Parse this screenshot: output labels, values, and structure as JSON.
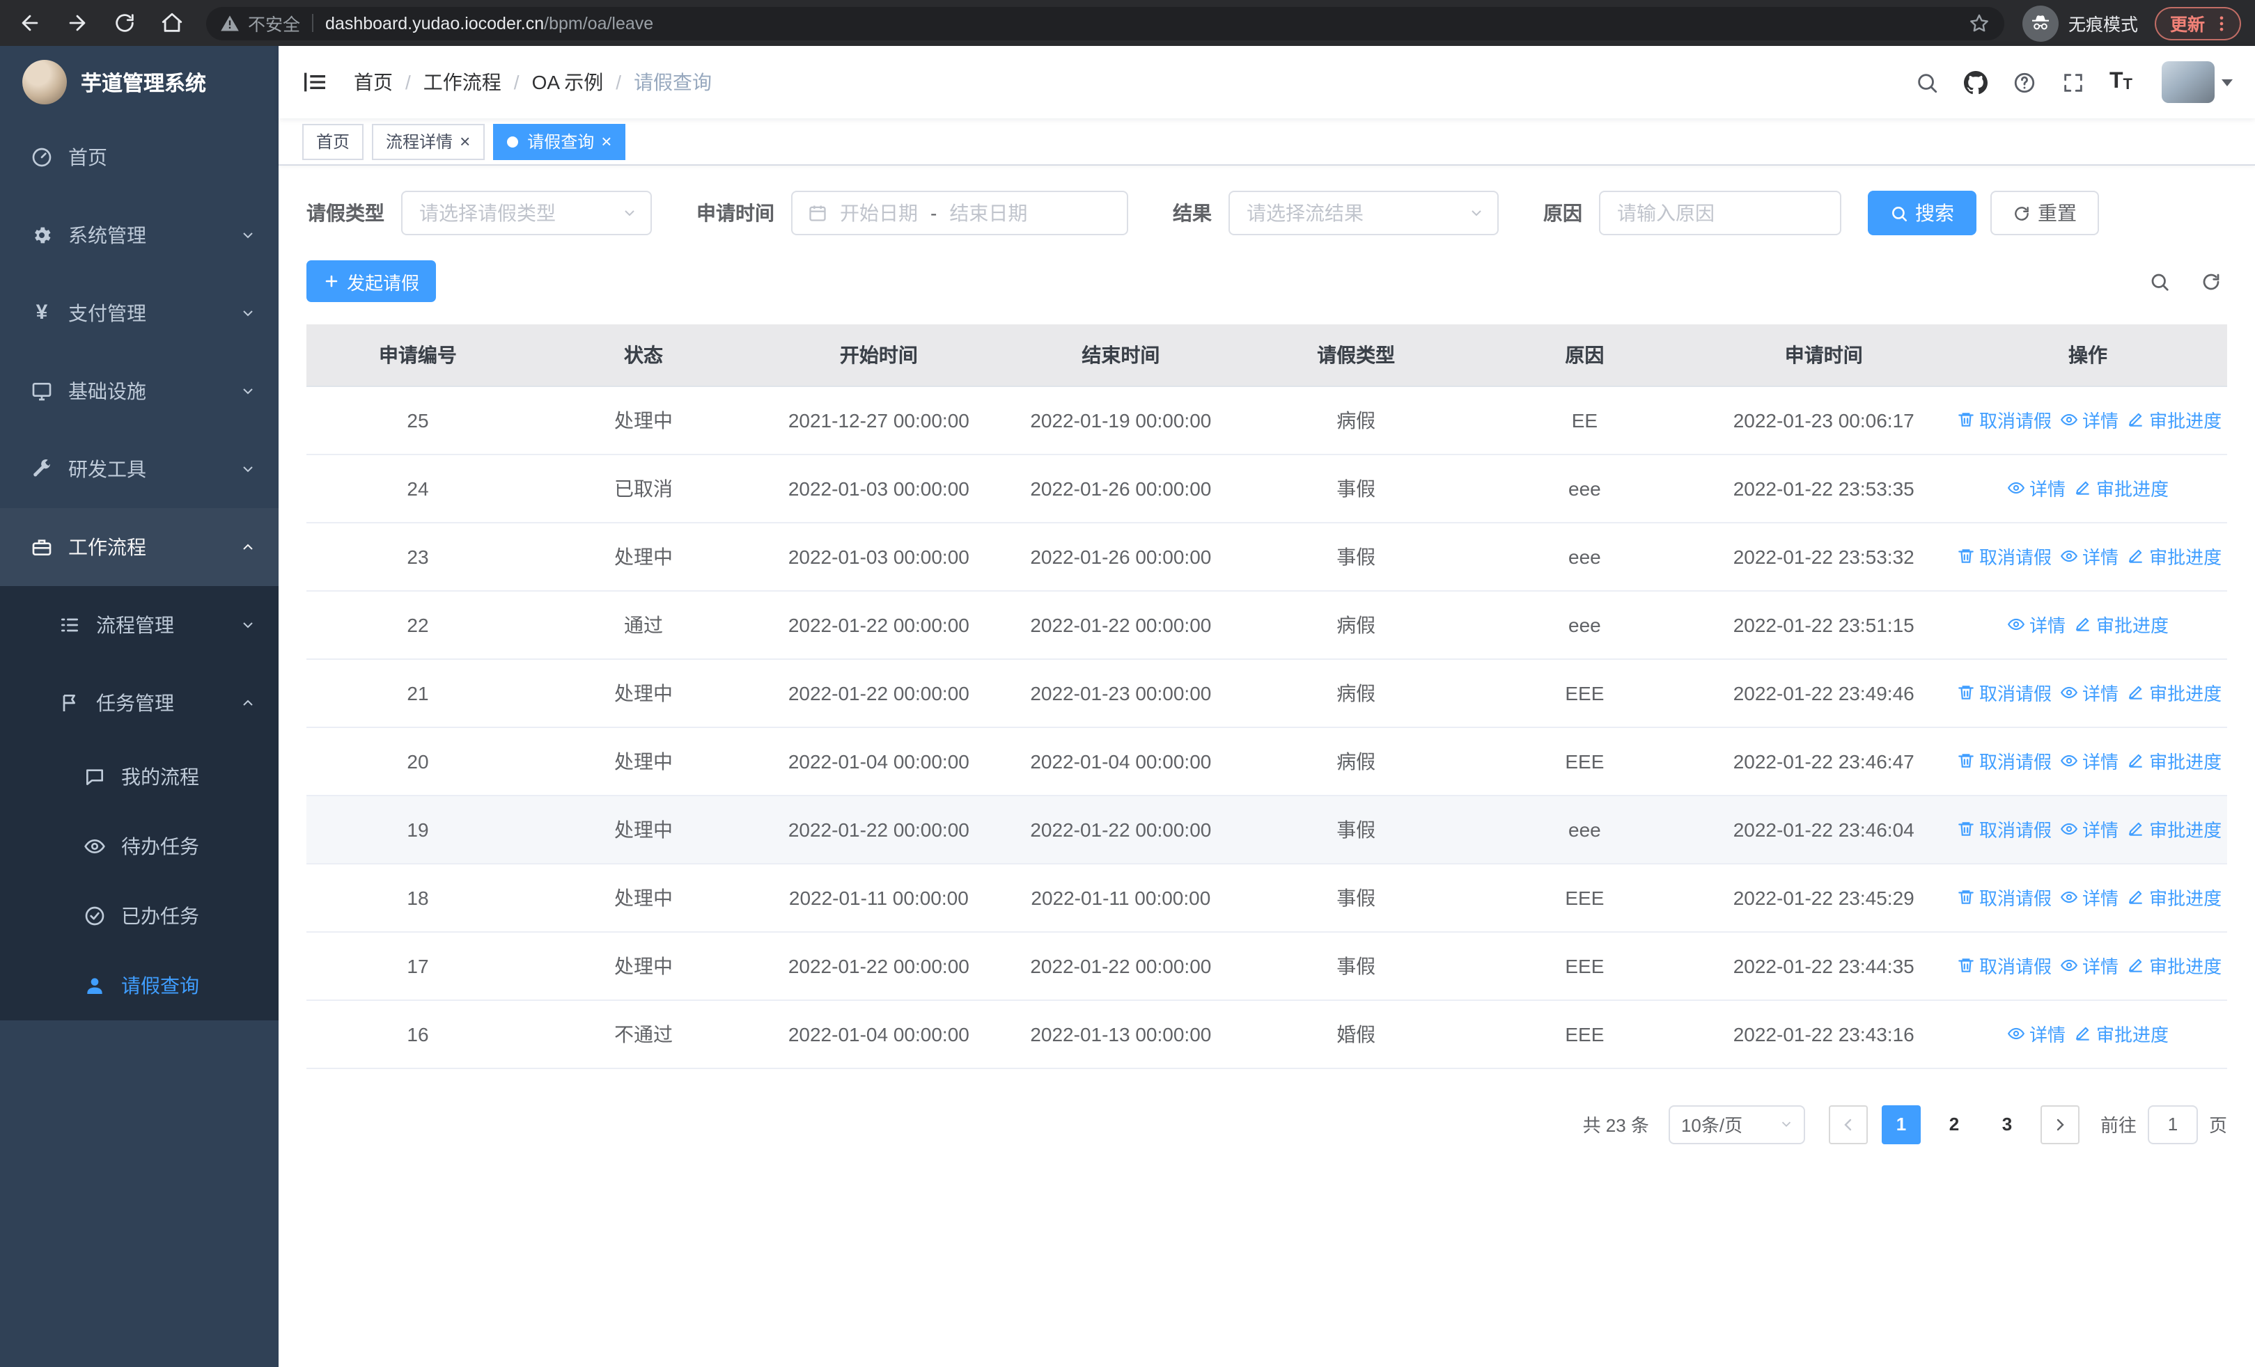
{
  "colors": {
    "accent": "#409eff",
    "sidebar_bg": "#304156",
    "submenu_bg": "#212d3d",
    "table_header_bg": "#e9e9eb"
  },
  "browser": {
    "security_label": "不安全",
    "url_host": "dashboard.yudao.iocoder.cn",
    "url_path": "/bpm/oa/leave",
    "incognito_label": "无痕模式",
    "update_label": "更新"
  },
  "sidebar": {
    "title": "芋道管理系统",
    "items": [
      {
        "label": "首页",
        "icon": "dashboard-icon"
      },
      {
        "label": "系统管理",
        "icon": "gear-icon"
      },
      {
        "label": "支付管理",
        "icon": "yen-icon"
      },
      {
        "label": "基础设施",
        "icon": "monitor-icon"
      },
      {
        "label": "研发工具",
        "icon": "wrench-icon"
      },
      {
        "label": "工作流程",
        "icon": "briefcase-icon"
      },
      {
        "label": "流程管理",
        "icon": "list-tree-icon"
      },
      {
        "label": "任务管理",
        "icon": "flag-icon"
      },
      {
        "label": "我的流程",
        "icon": "chat-icon"
      },
      {
        "label": "待办任务",
        "icon": "eye-icon"
      },
      {
        "label": "已办任务",
        "icon": "check-circle-icon"
      },
      {
        "label": "请假查询",
        "icon": "user-icon"
      }
    ]
  },
  "header": {
    "breadcrumb": [
      "首页",
      "工作流程",
      "OA 示例",
      "请假查询"
    ]
  },
  "tabs": [
    {
      "label": "首页"
    },
    {
      "label": "流程详情"
    },
    {
      "label": "请假查询"
    }
  ],
  "filters": {
    "leave_type_label": "请假类型",
    "leave_type_placeholder": "请选择请假类型",
    "apply_time_label": "申请时间",
    "start_date_placeholder": "开始日期",
    "range_separator": "-",
    "end_date_placeholder": "结束日期",
    "result_label": "结果",
    "result_placeholder": "请选择流结果",
    "reason_label": "原因",
    "reason_placeholder": "请输入原因",
    "search_label": "搜索",
    "reset_label": "重置"
  },
  "toolbar": {
    "create_label": "发起请假"
  },
  "table": {
    "columns": [
      "申请编号",
      "状态",
      "开始时间",
      "结束时间",
      "请假类型",
      "原因",
      "申请时间",
      "操作"
    ],
    "action_labels": {
      "cancel": "取消请假",
      "detail": "详情",
      "progress": "审批进度"
    },
    "action_icons": {
      "cancel": "delete-icon",
      "detail": "eye-icon",
      "progress": "edit-icon"
    },
    "rows": [
      {
        "id": "25",
        "status": "处理中",
        "start": "2021-12-27 00:00:00",
        "end": "2022-01-19 00:00:00",
        "type": "病假",
        "reason": "EE",
        "apply_time": "2022-01-23 00:06:17",
        "actions": [
          "cancel",
          "detail",
          "progress"
        ]
      },
      {
        "id": "24",
        "status": "已取消",
        "start": "2022-01-03 00:00:00",
        "end": "2022-01-26 00:00:00",
        "type": "事假",
        "reason": "eee",
        "apply_time": "2022-01-22 23:53:35",
        "actions": [
          "detail",
          "progress"
        ]
      },
      {
        "id": "23",
        "status": "处理中",
        "start": "2022-01-03 00:00:00",
        "end": "2022-01-26 00:00:00",
        "type": "事假",
        "reason": "eee",
        "apply_time": "2022-01-22 23:53:32",
        "actions": [
          "cancel",
          "detail",
          "progress"
        ]
      },
      {
        "id": "22",
        "status": "通过",
        "start": "2022-01-22 00:00:00",
        "end": "2022-01-22 00:00:00",
        "type": "病假",
        "reason": "eee",
        "apply_time": "2022-01-22 23:51:15",
        "actions": [
          "detail",
          "progress"
        ]
      },
      {
        "id": "21",
        "status": "处理中",
        "start": "2022-01-22 00:00:00",
        "end": "2022-01-23 00:00:00",
        "type": "病假",
        "reason": "EEE",
        "apply_time": "2022-01-22 23:49:46",
        "actions": [
          "cancel",
          "detail",
          "progress"
        ]
      },
      {
        "id": "20",
        "status": "处理中",
        "start": "2022-01-04 00:00:00",
        "end": "2022-01-04 00:00:00",
        "type": "病假",
        "reason": "EEE",
        "apply_time": "2022-01-22 23:46:47",
        "actions": [
          "cancel",
          "detail",
          "progress"
        ]
      },
      {
        "id": "19",
        "status": "处理中",
        "start": "2022-01-22 00:00:00",
        "end": "2022-01-22 00:00:00",
        "type": "事假",
        "reason": "eee",
        "apply_time": "2022-01-22 23:46:04",
        "actions": [
          "cancel",
          "detail",
          "progress"
        ],
        "highlight": true
      },
      {
        "id": "18",
        "status": "处理中",
        "start": "2022-01-11 00:00:00",
        "end": "2022-01-11 00:00:00",
        "type": "事假",
        "reason": "EEE",
        "apply_time": "2022-01-22 23:45:29",
        "actions": [
          "cancel",
          "detail",
          "progress"
        ]
      },
      {
        "id": "17",
        "status": "处理中",
        "start": "2022-01-22 00:00:00",
        "end": "2022-01-22 00:00:00",
        "type": "事假",
        "reason": "EEE",
        "apply_time": "2022-01-22 23:44:35",
        "actions": [
          "cancel",
          "detail",
          "progress"
        ]
      },
      {
        "id": "16",
        "status": "不通过",
        "start": "2022-01-04 00:00:00",
        "end": "2022-01-13 00:00:00",
        "type": "婚假",
        "reason": "EEE",
        "apply_time": "2022-01-22 23:43:16",
        "actions": [
          "detail",
          "progress"
        ]
      }
    ]
  },
  "pagination": {
    "total_label": "共 23 条",
    "page_size_label": "10条/页",
    "pages": [
      "1",
      "2",
      "3"
    ],
    "active_page": "1",
    "goto_label": "前往",
    "goto_value": "1",
    "page_unit_label": "页"
  }
}
